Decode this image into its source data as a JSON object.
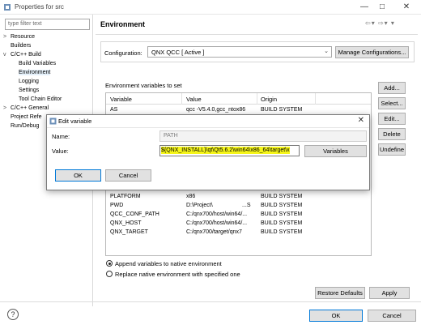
{
  "window": {
    "title": "Properties for src"
  },
  "sidebar": {
    "filter_placeholder": "type filter text",
    "items": [
      {
        "label": "Resource",
        "chevron": ">"
      },
      {
        "label": "Builders",
        "chevron": ""
      },
      {
        "label": "C/C++ Build",
        "chevron": "v"
      },
      {
        "label": "Build Variables",
        "chevron": ""
      },
      {
        "label": "Environment",
        "chevron": ""
      },
      {
        "label": "Logging",
        "chevron": ""
      },
      {
        "label": "Settings",
        "chevron": ""
      },
      {
        "label": "Tool Chain Editor",
        "chevron": ""
      },
      {
        "label": "C/C++ General",
        "chevron": ">"
      },
      {
        "label": "Project Refe",
        "chevron": ""
      },
      {
        "label": "Run/Debug",
        "chevron": ""
      }
    ]
  },
  "page": {
    "title": "Environment",
    "configuration_label": "Configuration:",
    "configuration_value": "QNX QCC  [ Active ]",
    "manage_button": "Manage Configurations...",
    "env_label": "Environment variables to set"
  },
  "table": {
    "headers": [
      "Variable",
      "Value",
      "Origin"
    ],
    "rows_top": [
      {
        "variable": "AS",
        "value": "qcc -V5.4.0,gcc_ntox86",
        "origin": "BUILD SYSTEM"
      }
    ],
    "rows_bottom": [
      {
        "variable": "PLATFORM",
        "value": "x86",
        "origin": "BUILD SYSTEM"
      },
      {
        "variable": "PWD",
        "value": "D:\\Project\\",
        "value_suffix": "...S",
        "origin": "BUILD SYSTEM"
      },
      {
        "variable": "QCC_CONF_PATH",
        "value": "C:/qnx700/host/win64/...",
        "origin": "BUILD SYSTEM"
      },
      {
        "variable": "QNX_HOST",
        "value": "C:/qnx700/host/win64/...",
        "origin": "BUILD SYSTEM"
      },
      {
        "variable": "QNX_TARGET",
        "value": "C:/qnx700/target/qnx7",
        "origin": "BUILD SYSTEM"
      }
    ]
  },
  "side_buttons": [
    "Add...",
    "Select...",
    "Edit...",
    "Delete",
    "Undefine"
  ],
  "radios": {
    "append": "Append variables to native environment",
    "replace": "Replace native environment with specified one"
  },
  "footer": {
    "restore": "Restore Defaults",
    "apply": "Apply",
    "ok": "OK",
    "cancel": "Cancel",
    "help": "?"
  },
  "dialog": {
    "title": "Edit variable",
    "name_label": "Name:",
    "name_value": "PATH",
    "value_label": "Value:",
    "value_text": "${QNX_INSTALL}\\qt\\Qt5.6.2\\win64\\x86_64\\target\\x",
    "variables_button": "Variables",
    "ok": "OK",
    "cancel": "Cancel"
  },
  "colors": {
    "highlight": "#f5f519",
    "accent": "#0078d7"
  }
}
